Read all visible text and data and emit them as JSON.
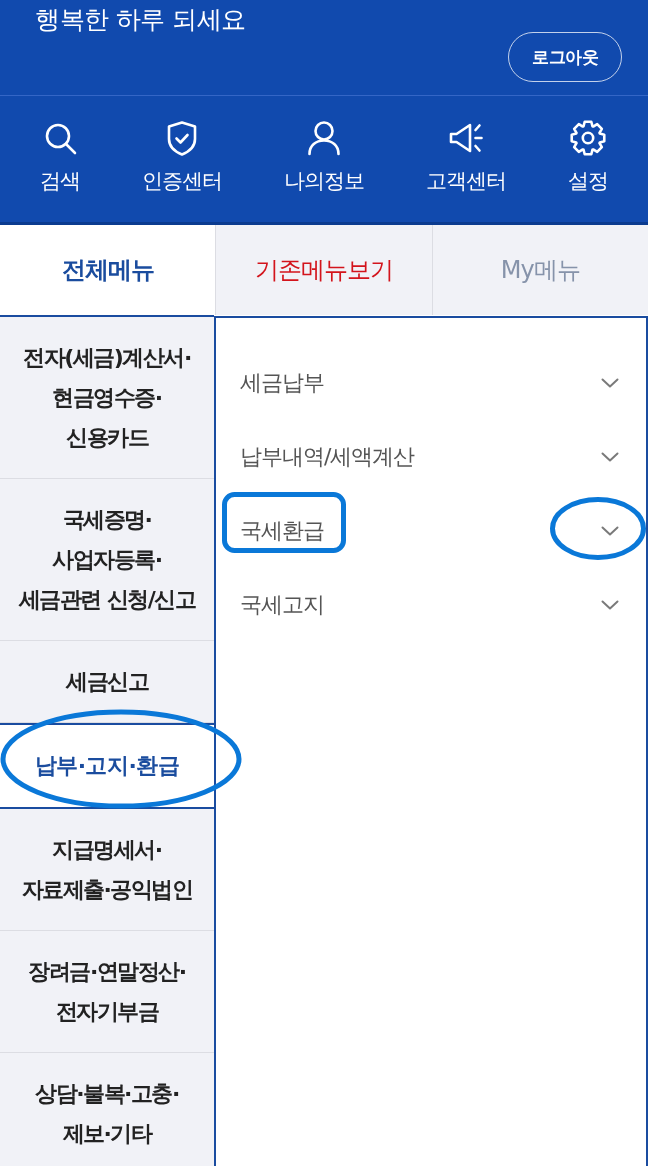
{
  "header": {
    "greeting": "행복한 하루 되세요",
    "logout_button": "로그아웃"
  },
  "quick_menu": [
    {
      "kind": "search",
      "label": "검색"
    },
    {
      "kind": "shield",
      "label": "인증센터"
    },
    {
      "kind": "person",
      "label": "나의정보"
    },
    {
      "kind": "megaphone",
      "label": "고객센터"
    },
    {
      "kind": "gear",
      "label": "설정"
    }
  ],
  "tabs": [
    {
      "label": "전체메뉴",
      "selected": true,
      "kind": "plain"
    },
    {
      "label": "기존메뉴보기",
      "selected": false,
      "kind": "accent"
    },
    {
      "label": "My메뉴",
      "selected": false,
      "kind": "plain"
    }
  ],
  "sidebar": {
    "items": [
      {
        "label": "전자(세금)계산서·\n현금영수증·\n신용카드",
        "selected": false,
        "circled": false
      },
      {
        "label": "국세증명·\n사업자등록·\n세금관련 신청/신고",
        "selected": false,
        "circled": false
      },
      {
        "label": "세금신고",
        "selected": false,
        "circled": false
      },
      {
        "label": "납부·고지·환급",
        "selected": true,
        "circled": true
      },
      {
        "label": "지급명세서·\n자료제출·공익법인",
        "selected": false,
        "circled": false
      },
      {
        "label": "장려금·연말정산·\n전자기부금",
        "selected": false,
        "circled": false
      },
      {
        "label": "상담·불복·고충·\n제보·기타",
        "selected": false,
        "circled": false
      }
    ]
  },
  "panel": {
    "items": [
      {
        "label": "세금납부",
        "expanded": false,
        "label_circled": false,
        "chevron_circled": false
      },
      {
        "label": "납부내역/세액계산",
        "expanded": false,
        "label_circled": false,
        "chevron_circled": false
      },
      {
        "label": "국세환급",
        "expanded": false,
        "label_circled": true,
        "chevron_circled": true
      },
      {
        "label": "국세고지",
        "expanded": false,
        "label_circled": false,
        "chevron_circled": false
      }
    ]
  }
}
